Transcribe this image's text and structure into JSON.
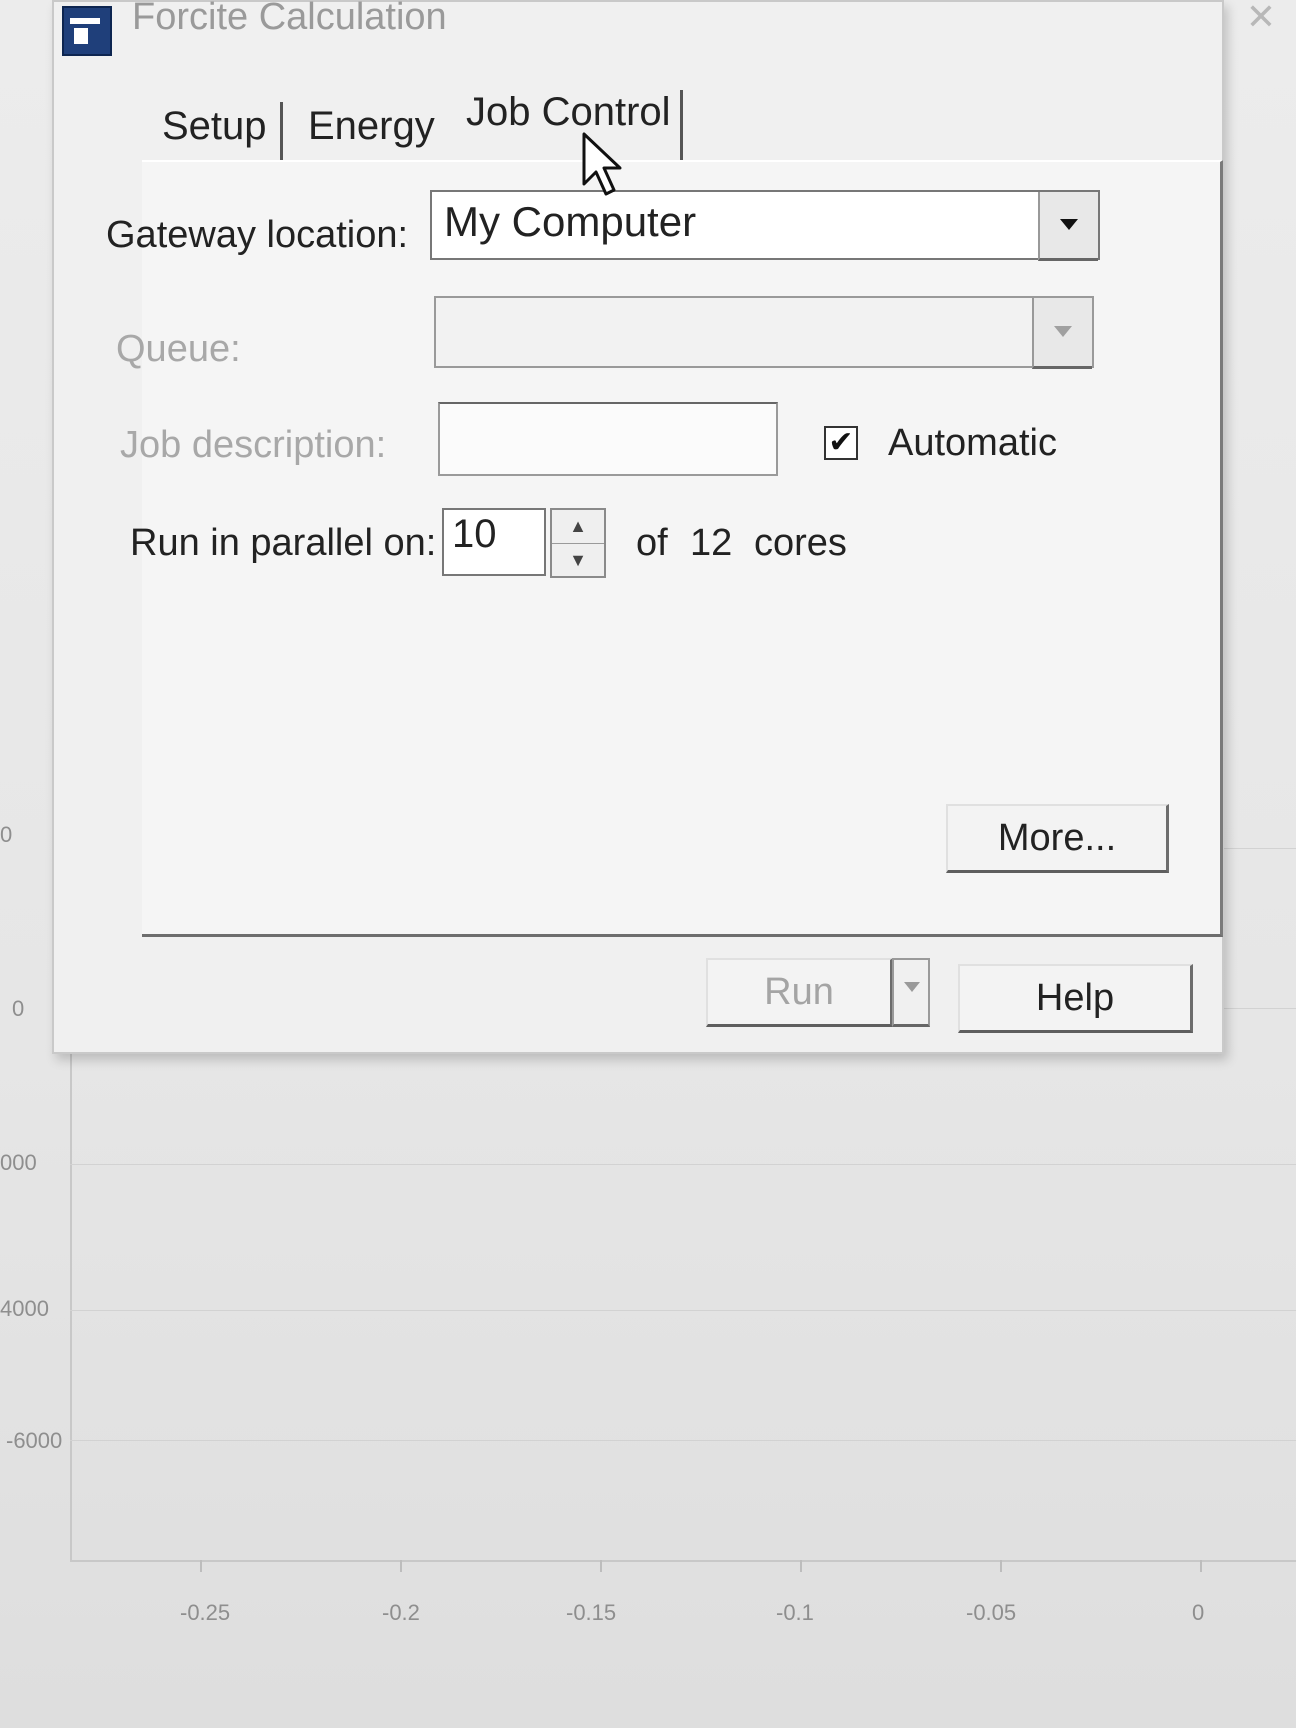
{
  "window": {
    "title": "Forcite Calculation"
  },
  "tabs": [
    {
      "label": "Setup"
    },
    {
      "label": "Energy"
    },
    {
      "label": "Job Control",
      "selected": true
    }
  ],
  "job_control": {
    "gateway_label": "Gateway location:",
    "gateway_value": "My Computer",
    "queue_label": "Queue:",
    "queue_value": "",
    "job_description_label": "Job description:",
    "job_description_value": "",
    "automatic_label": "Automatic",
    "automatic_checked": true,
    "parallel_label": "Run in parallel on:",
    "parallel_value": "10",
    "of_label": "of",
    "cores_total": "12",
    "cores_label": "cores",
    "more_button": "More..."
  },
  "footer": {
    "run_button": "Run",
    "help_button": "Help"
  },
  "background_plot": {
    "y_ticks": [
      "0",
      "0",
      "000",
      "4000",
      "-6000"
    ],
    "x_ticks": [
      "-0.25",
      "-0.2",
      "-0.15",
      "-0.1",
      "-0.05",
      "0"
    ]
  }
}
